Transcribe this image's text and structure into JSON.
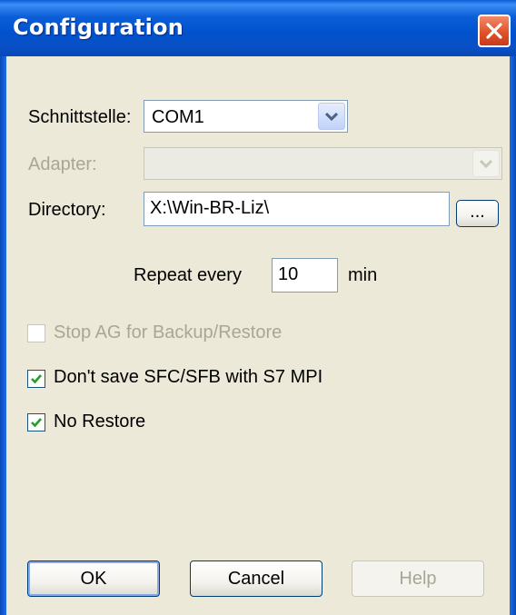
{
  "window": {
    "title": "Configuration"
  },
  "icons": {
    "close": "close-icon",
    "dropdown": "chevron-down-icon",
    "check": "checkmark-icon"
  },
  "colors": {
    "titlebar": "#0052cc",
    "close_button": "#e0542a",
    "face": "#ece9d8",
    "disabled_text": "#a8a694"
  },
  "form": {
    "interface_label": "Schnittstelle:",
    "interface_value": "COM1",
    "adapter_label": "Adapter:",
    "adapter_value": "",
    "directory_label": "Directory:",
    "directory_value": "X:\\Win-BR-Liz\\",
    "browse_label": "...",
    "repeat_label": "Repeat every",
    "repeat_value": "10",
    "repeat_unit": "min"
  },
  "options": [
    {
      "label": "Stop AG for Backup/Restore",
      "checked": false,
      "enabled": false
    },
    {
      "label": "Don't save SFC/SFB with S7 MPI",
      "checked": true,
      "enabled": true
    },
    {
      "label": "No Restore",
      "checked": true,
      "enabled": true
    }
  ],
  "buttons": {
    "ok": "OK",
    "cancel": "Cancel",
    "help": "Help"
  }
}
